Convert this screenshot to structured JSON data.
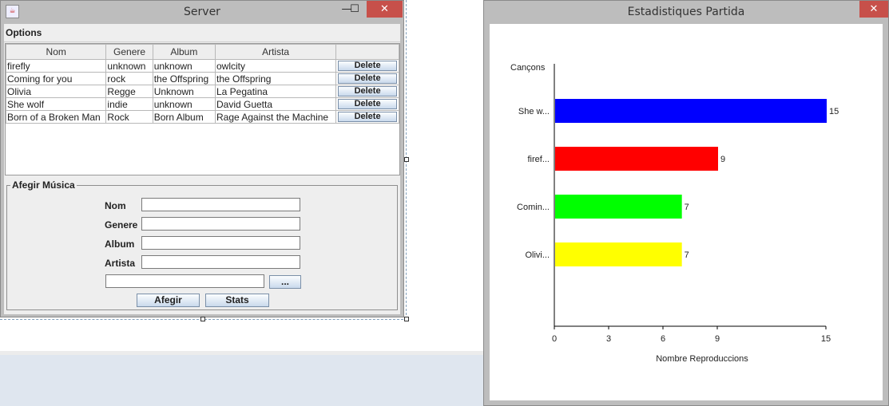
{
  "server_window": {
    "title": "Server",
    "minimize_symbol": "—",
    "maximize_symbol": "☐",
    "close_symbol": "✕",
    "app_icon": "java-icon",
    "menu": {
      "options_label": "Options"
    },
    "table": {
      "headers": [
        "Nom",
        "Genere",
        "Album",
        "Artista",
        ""
      ],
      "delete_label": "Delete",
      "rows": [
        {
          "nom": "firefly",
          "genere": "unknown",
          "album": "unknown",
          "artista": "owlcity"
        },
        {
          "nom": "Coming for you",
          "genere": "rock",
          "album": "the Offspring",
          "artista": "the Offspring"
        },
        {
          "nom": "Olivia",
          "genere": "Regge",
          "album": "Unknown",
          "artista": "La Pegatina"
        },
        {
          "nom": "She wolf",
          "genere": "indie",
          "album": "unknown",
          "artista": "David Guetta"
        },
        {
          "nom": "Born of a Broken Man",
          "genere": "Rock",
          "album": "Born Album",
          "artista": "Rage Against the Machine"
        }
      ]
    },
    "add_panel": {
      "legend": "Afegir Música",
      "nom_label": "Nom",
      "genere_label": "Genere",
      "album_label": "Album",
      "artista_label": "Artista",
      "nom_value": "",
      "genere_value": "",
      "album_value": "",
      "artista_value": "",
      "file_value": "",
      "browse_label": "...",
      "add_label": "Afegir",
      "stats_label": "Stats"
    }
  },
  "stats_window": {
    "title": "Estadistiques Partida",
    "close_symbol": "✕"
  },
  "chart_data": {
    "type": "bar",
    "orientation": "horizontal",
    "title": "",
    "categories": [
      "She w...",
      "firef...",
      "Comin...",
      "Olivi..."
    ],
    "values": [
      15,
      9,
      7,
      7
    ],
    "colors": [
      "#0000ff",
      "#ff0000",
      "#00ff00",
      "#ffff00"
    ],
    "value_labels": [
      "15",
      "9",
      "7",
      "7"
    ],
    "xlabel": "Nombre Reproduccions",
    "ylabel": "Cançons",
    "xlim": [
      0,
      15
    ],
    "xticks": [
      "0",
      "3",
      "6",
      "9",
      "15"
    ],
    "grid": false,
    "legend": "none"
  }
}
